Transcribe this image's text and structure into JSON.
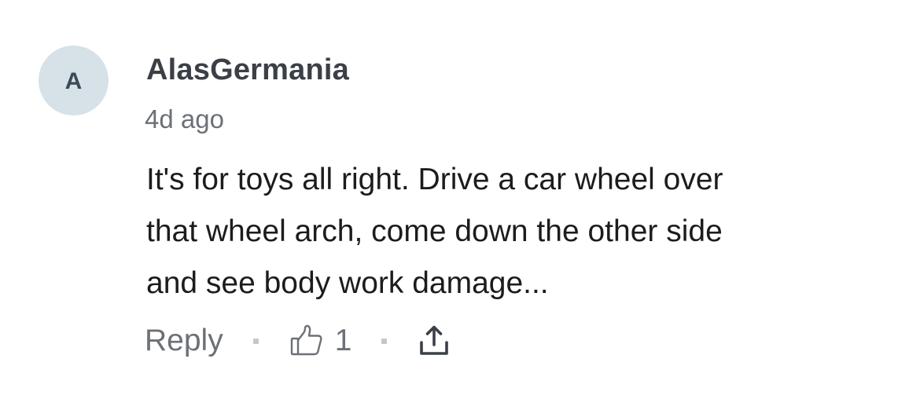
{
  "comment": {
    "avatar_letter": "A",
    "username": "AlasGermania",
    "timestamp": "4d ago",
    "body_lines": [
      "It's for toys all right. Drive a car wheel over",
      "that wheel arch, come down the other side",
      "and see body work damage..."
    ],
    "actions": {
      "reply_label": "Reply",
      "like_count": "1",
      "like_icon": "thumbs-up-icon",
      "share_icon": "share-icon"
    },
    "colors": {
      "avatar_bg": "#d6e1e8",
      "username": "#3b4047",
      "muted": "#6c7178",
      "body": "#1c1c1c"
    }
  }
}
